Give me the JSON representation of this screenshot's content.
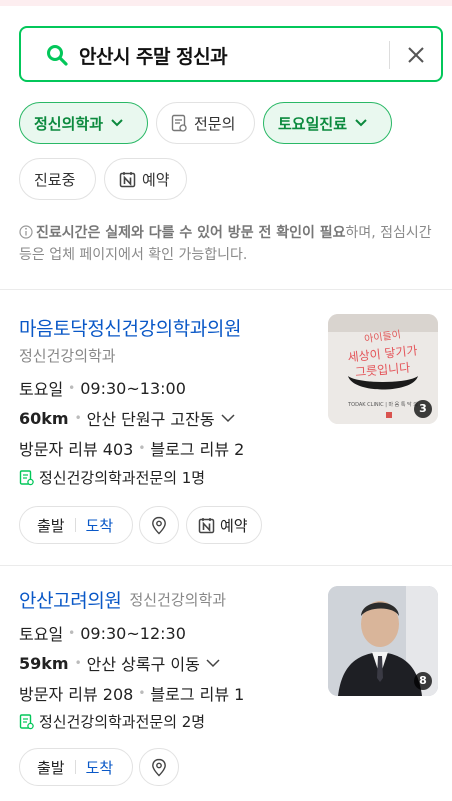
{
  "search": {
    "query": "안산시 주말 정신과",
    "icon": "search-icon",
    "clear_icon": "close-icon",
    "accent": "#03c75a"
  },
  "filters": [
    {
      "label": "정신의학과",
      "active": true,
      "icon": "chevron-down-icon"
    },
    {
      "label": "전문의",
      "active": false,
      "icon": "certificate-icon"
    },
    {
      "label": "토요일진료",
      "active": true,
      "icon": "chevron-down-icon"
    },
    {
      "label": "진료중",
      "active": false
    },
    {
      "label": "예약",
      "active": false,
      "icon": "naver-booking-icon"
    }
  ],
  "notice": {
    "bold": "진료시간은 실제와 다를 수 있어 방문 전 확인이 필요",
    "rest": "하며, 점심시간 등은 업체 페이지에서 확인 가능합니다."
  },
  "results": [
    {
      "name": "마음토닥정신건강의학과의원",
      "category": "정신건강의학과",
      "day": "토요일",
      "hours": "09:30~13:00",
      "distance": "60km",
      "address": "안산 단원구 고잔동",
      "visitor_reviews": "방문자 리뷰 403",
      "blog_reviews": "블로그 리뷰 2",
      "specialists": "정신건강의학과전문의 1명",
      "depart_label": "출발",
      "arrive_label": "도착",
      "reserve_label": "예약",
      "photo_count": "3",
      "photo_text": "마음을 세상이 닿기가 그릇입니다",
      "photo_caption": "TODAK CLINIC | 마 음 톡 닥 의"
    },
    {
      "name": "안산고려의원",
      "category": "정신건강의학과",
      "day": "토요일",
      "hours": "09:30~12:30",
      "distance": "59km",
      "address": "안산 상록구 이동",
      "visitor_reviews": "방문자 리뷰 208",
      "blog_reviews": "블로그 리뷰 1",
      "specialists": "정신건강의학과전문의 2명",
      "depart_label": "출발",
      "arrive_label": "도착",
      "photo_count": "8"
    }
  ]
}
